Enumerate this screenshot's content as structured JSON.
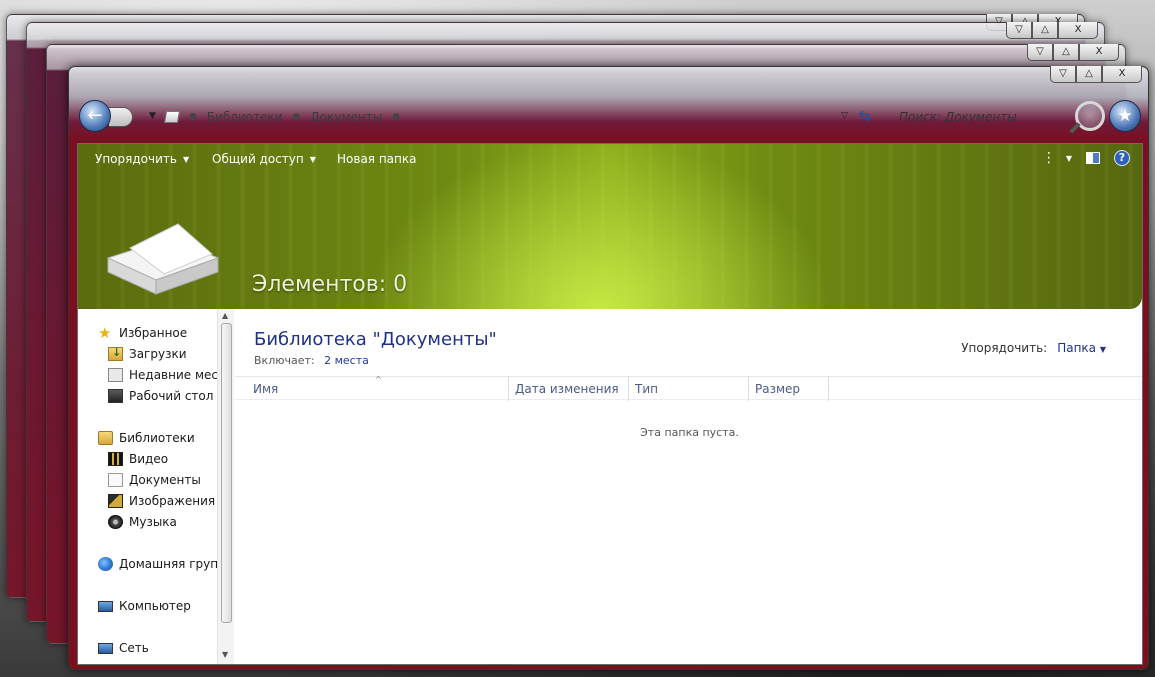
{
  "window": {
    "caption_buttons": [
      "▽",
      "△",
      "X"
    ]
  },
  "address_bar": {
    "segments": [
      "Библиотеки",
      "Документы"
    ],
    "search_placeholder": "Поиск: Документы"
  },
  "toolbar": {
    "organize": "Упорядочить",
    "share": "Общий доступ",
    "new_folder": "Новая папка"
  },
  "banner": {
    "item_count": "Элементов: 0"
  },
  "sidebar": {
    "favorites": {
      "label": "Избранное",
      "items": [
        "Загрузки",
        "Недавние места",
        "Рабочий стол"
      ]
    },
    "libraries": {
      "label": "Библиотеки",
      "items": [
        "Видео",
        "Документы",
        "Изображения",
        "Музыка"
      ]
    },
    "homegroup": "Домашняя группа",
    "computer": "Компьютер",
    "network": "Сеть"
  },
  "library": {
    "title": "Библиотека \"Документы\"",
    "includes_label": "Включает:",
    "includes_link": "2 места",
    "arrange_label": "Упорядочить:",
    "arrange_value": "Папка"
  },
  "columns": [
    "Имя",
    "Дата изменения",
    "Тип",
    "Размер"
  ],
  "empty_message": "Эта папка пуста.",
  "colors": {
    "title_blue": "#1e3287",
    "banner_green": "#8ead1c",
    "frame_red": "#7a0f1f"
  }
}
